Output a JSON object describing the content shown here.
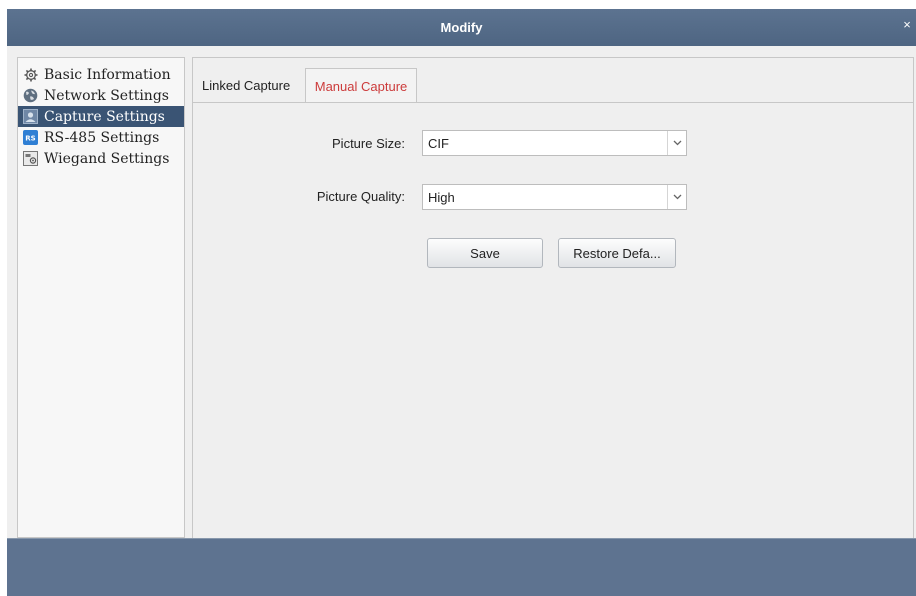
{
  "window": {
    "title": "Modify",
    "close_glyph": "×",
    "title_bar_color": "#5a718d",
    "footer_color": "#5e7390",
    "accent_text_color": "#cc3b3b"
  },
  "sidebar": {
    "items": [
      {
        "label": "Basic Information",
        "icon": "gear-icon",
        "active": false
      },
      {
        "label": "Network Settings",
        "icon": "globe-icon",
        "active": false
      },
      {
        "label": "Capture Settings",
        "icon": "camera-icon",
        "active": true
      },
      {
        "label": "RS-485 Settings",
        "icon": "rs-badge-icon",
        "active": false
      },
      {
        "label": "Wiegand Settings",
        "icon": "wiegand-icon",
        "active": false
      }
    ]
  },
  "tabs": [
    {
      "label": "Linked Capture",
      "active": false
    },
    {
      "label": "Manual Capture",
      "active": true
    }
  ],
  "form": {
    "picture_size": {
      "label": "Picture Size:",
      "value": "CIF"
    },
    "picture_quality": {
      "label": "Picture Quality:",
      "value": "High"
    },
    "save_label": "Save",
    "restore_label": "Restore Defa..."
  }
}
